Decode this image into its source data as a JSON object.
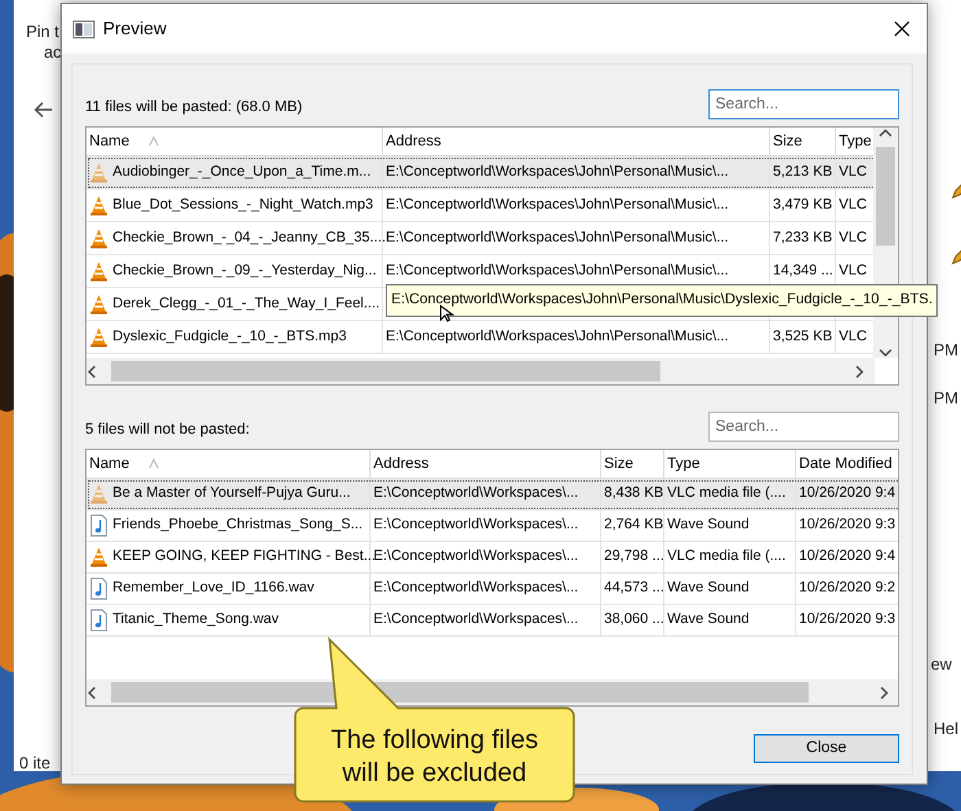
{
  "background_window": {
    "pin_label": "Pin t",
    "pin_label_2": "ac",
    "status_text": "0 ite",
    "time_fields": [
      "PM",
      "PM"
    ],
    "side_buttons": [
      "ew",
      "Hel"
    ]
  },
  "dialog": {
    "title": "Preview",
    "pasted": {
      "summary": "11 files will be pasted: (68.0 MB)",
      "search": {
        "placeholder": "Search...",
        "focused": true
      },
      "columns": [
        "Name",
        "Address",
        "Size",
        "Type"
      ],
      "rows": [
        {
          "kind": "vlc",
          "selected": true,
          "cells": [
            "Audiobinger_-_Once_Upon_a_Time.m...",
            "E:\\Conceptworld\\Workspaces\\John\\Personal\\Music\\...",
            "5,213 KB",
            "VLC"
          ]
        },
        {
          "kind": "vlc",
          "selected": false,
          "cells": [
            "Blue_Dot_Sessions_-_Night_Watch.mp3",
            "E:\\Conceptworld\\Workspaces\\John\\Personal\\Music\\...",
            "3,479 KB",
            "VLC"
          ]
        },
        {
          "kind": "vlc",
          "selected": false,
          "cells": [
            "Checkie_Brown_-_04_-_Jeanny_CB_35....",
            "E:\\Conceptworld\\Workspaces\\John\\Personal\\Music\\...",
            "7,233 KB",
            "VLC"
          ]
        },
        {
          "kind": "vlc",
          "selected": false,
          "cells": [
            "Checkie_Brown_-_09_-_Yesterday_Nig...",
            "E:\\Conceptworld\\Workspaces\\John\\Personal\\Music\\...",
            "14,349 ...",
            "VLC"
          ]
        },
        {
          "kind": "vlc",
          "selected": false,
          "cells": [
            "Derek_Clegg_-_01_-_The_Way_I_Feel...."
          ]
        },
        {
          "kind": "vlc",
          "selected": false,
          "cells": [
            "Dyslexic_Fudgicle_-_10_-_BTS.mp3",
            "E:\\Conceptworld\\Workspaces\\John\\Personal\\Music\\...",
            "3,525 KB",
            "VLC"
          ]
        }
      ],
      "tooltip": "E:\\Conceptworld\\Workspaces\\John\\Personal\\Music\\Dyslexic_Fudgicle_-_10_-_BTS."
    },
    "excluded": {
      "summary": "5 files will not be pasted:",
      "search": {
        "placeholder": "Search...",
        "focused": false
      },
      "columns": [
        "Name",
        "Address",
        "Size",
        "Type",
        "Date Modified"
      ],
      "rows": [
        {
          "kind": "vlc",
          "selected": true,
          "cells": [
            "Be a Master of Yourself-Pujya Guru...",
            "E:\\Conceptworld\\Workspaces\\...",
            "8,438 KB",
            "VLC media file (....",
            "10/26/2020 9:4"
          ]
        },
        {
          "kind": "wav",
          "selected": false,
          "cells": [
            "Friends_Phoebe_Christmas_Song_S...",
            "E:\\Conceptworld\\Workspaces\\...",
            "2,764 KB",
            "Wave Sound",
            "10/26/2020 9:3"
          ]
        },
        {
          "kind": "vlc",
          "selected": false,
          "cells": [
            "KEEP GOING, KEEP FIGHTING - Best...",
            "E:\\Conceptworld\\Workspaces\\...",
            "29,798 ...",
            "VLC media file (....",
            "10/26/2020 9:4"
          ]
        },
        {
          "kind": "wav",
          "selected": false,
          "cells": [
            "Remember_Love_ID_1166.wav",
            "E:\\Conceptworld\\Workspaces\\...",
            "44,573 ...",
            "Wave Sound",
            "10/26/2020 9:2"
          ]
        },
        {
          "kind": "wav",
          "selected": false,
          "cells": [
            "Titanic_Theme_Song.wav",
            "E:\\Conceptworld\\Workspaces\\...",
            "38,060 ...",
            "Wave Sound",
            "10/26/2020 9:3"
          ]
        }
      ]
    },
    "close_button": "Close",
    "callout": "The following files\nwill be excluded"
  }
}
